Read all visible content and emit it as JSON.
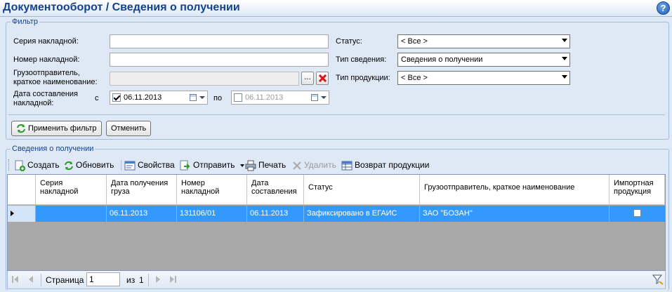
{
  "header": {
    "title": "Документооборот  / Сведения о получении",
    "help_glyph": "?"
  },
  "filter": {
    "legend": "Фильтр",
    "series_label": "Серия накладной:",
    "series_value": "",
    "number_label": "Номер накладной:",
    "number_value": "",
    "shipper_label_1": "Грузоотправитель,",
    "shipper_label_2": "краткое наименование:",
    "shipper_value": "",
    "browse_label": "...",
    "date_label_1": "Дата составления",
    "date_label_2": "накладной:",
    "date_from_prefix": "с",
    "date_from": "06.11.2013",
    "date_from_checked": true,
    "date_to_prefix": "по",
    "date_to": "06.11.2013",
    "date_to_checked": false,
    "status_label": "Статус:",
    "status_value": "< Все >",
    "info_type_label": "Тип сведения:",
    "info_type_value": "Сведения о получении",
    "product_type_label": "Тип продукции:",
    "product_type_value": "< Все >",
    "apply_label": "Применить фильтр",
    "cancel_label": "Отменить"
  },
  "section": {
    "legend": "Сведения о получении"
  },
  "toolbar": {
    "create": "Создать",
    "refresh": "Обновить",
    "properties": "Свойства",
    "send": "Отправить",
    "print": "Печать",
    "delete": "Удалить",
    "return": "Возврат продукции"
  },
  "grid": {
    "columns": [
      "Серия накладной",
      "Дата получения груза",
      "Номер накладной",
      "Дата составления",
      "Статус",
      "Грузоотправитель, краткое наименование",
      "Импортная продукция"
    ],
    "rows": [
      {
        "series": "",
        "received": "06.11.2013",
        "number": "131106/01",
        "created": "06.11.2013",
        "status": "Зафиксировано в ЕГАИС",
        "shipper": "ЗАО \"БОЗАН\"",
        "imported": false
      }
    ]
  },
  "pager": {
    "page_label": "Страница",
    "page_value": "1",
    "of_label": "из",
    "total_pages": "1"
  },
  "colors": {
    "title": "#15428b",
    "selected_row": "#3399ff",
    "grid_bg": "#a9a9a9",
    "page_bg": "#dfe9f5"
  }
}
